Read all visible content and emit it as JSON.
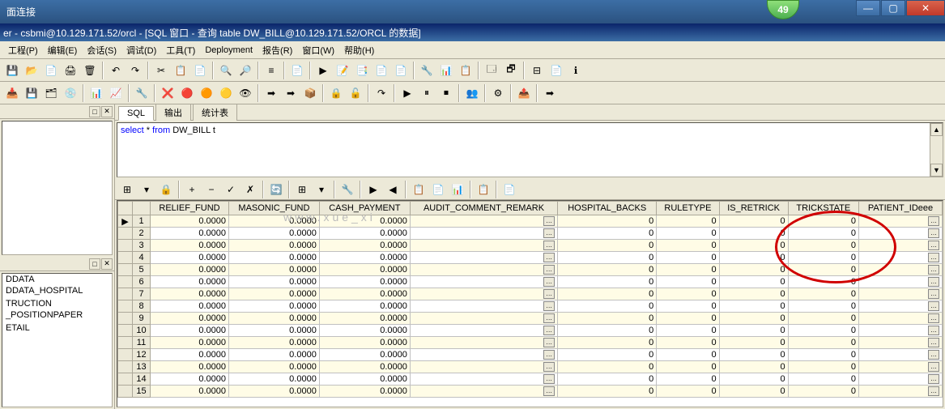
{
  "taskbar": {
    "title": "面连接",
    "badge": "49"
  },
  "titlebar": "er - csbmi@10.129.171.52/orcl - [SQL 窗口 - 查询 table DW_BILL@10.129.171.52/ORCL 的数据]",
  "menu": [
    "工程(P)",
    "编辑(E)",
    "会话(S)",
    "调试(D)",
    "工具(T)",
    "Deployment",
    "报告(R)",
    "窗口(W)",
    "帮助(H)"
  ],
  "tabs": {
    "sql": "SQL",
    "output": "输出",
    "stats": "统计表"
  },
  "sql": {
    "kw_select": "select",
    "star": " * ",
    "kw_from": "from",
    "table": " DW_BILL t"
  },
  "tree_items": [
    "DDATA",
    "DDATA_HOSPITAL",
    "",
    "TRUCTION",
    "_POSITIONPAPER",
    "",
    "ETAIL"
  ],
  "watermark": "www.xue_xi",
  "columns": [
    "RELIEF_FUND",
    "MASONIC_FUND",
    "CASH_PAYMENT",
    "AUDIT_COMMENT_REMARK",
    "HOSPITAL_BACKS",
    "RULETYPE",
    "IS_RETRICK",
    "TRICKSTATE",
    "PATIENT_IDeee"
  ],
  "rows": [
    {
      "n": 1,
      "mark": "▶",
      "r": "0.0000",
      "m": "0.0000",
      "c": "0.0000",
      "a": "…",
      "h": "0",
      "ru": "0",
      "ir": "0",
      "ts": "0",
      "p": "…"
    },
    {
      "n": 2,
      "mark": "",
      "r": "0.0000",
      "m": "0.0000",
      "c": "0.0000",
      "a": "…",
      "h": "0",
      "ru": "0",
      "ir": "0",
      "ts": "0",
      "p": "…"
    },
    {
      "n": 3,
      "mark": "",
      "r": "0.0000",
      "m": "0.0000",
      "c": "0.0000",
      "a": "…",
      "h": "0",
      "ru": "0",
      "ir": "0",
      "ts": "0",
      "p": "…"
    },
    {
      "n": 4,
      "mark": "",
      "r": "0.0000",
      "m": "0.0000",
      "c": "0.0000",
      "a": "…",
      "h": "0",
      "ru": "0",
      "ir": "0",
      "ts": "0",
      "p": "…"
    },
    {
      "n": 5,
      "mark": "",
      "r": "0.0000",
      "m": "0.0000",
      "c": "0.0000",
      "a": "…",
      "h": "0",
      "ru": "0",
      "ir": "0",
      "ts": "0",
      "p": "…"
    },
    {
      "n": 6,
      "mark": "",
      "r": "0.0000",
      "m": "0.0000",
      "c": "0.0000",
      "a": "…",
      "h": "0",
      "ru": "0",
      "ir": "0",
      "ts": "0",
      "p": "…"
    },
    {
      "n": 7,
      "mark": "",
      "r": "0.0000",
      "m": "0.0000",
      "c": "0.0000",
      "a": "…",
      "h": "0",
      "ru": "0",
      "ir": "0",
      "ts": "0",
      "p": "…"
    },
    {
      "n": 8,
      "mark": "",
      "r": "0.0000",
      "m": "0.0000",
      "c": "0.0000",
      "a": "…",
      "h": "0",
      "ru": "0",
      "ir": "0",
      "ts": "0",
      "p": "…"
    },
    {
      "n": 9,
      "mark": "",
      "r": "0.0000",
      "m": "0.0000",
      "c": "0.0000",
      "a": "…",
      "h": "0",
      "ru": "0",
      "ir": "0",
      "ts": "0",
      "p": "…"
    },
    {
      "n": 10,
      "mark": "",
      "r": "0.0000",
      "m": "0.0000",
      "c": "0.0000",
      "a": "…",
      "h": "0",
      "ru": "0",
      "ir": "0",
      "ts": "0",
      "p": "…"
    },
    {
      "n": 11,
      "mark": "",
      "r": "0.0000",
      "m": "0.0000",
      "c": "0.0000",
      "a": "…",
      "h": "0",
      "ru": "0",
      "ir": "0",
      "ts": "0",
      "p": "…"
    },
    {
      "n": 12,
      "mark": "",
      "r": "0.0000",
      "m": "0.0000",
      "c": "0.0000",
      "a": "…",
      "h": "0",
      "ru": "0",
      "ir": "0",
      "ts": "0",
      "p": "…"
    },
    {
      "n": 13,
      "mark": "",
      "r": "0.0000",
      "m": "0.0000",
      "c": "0.0000",
      "a": "…",
      "h": "0",
      "ru": "0",
      "ir": "0",
      "ts": "0",
      "p": "…"
    },
    {
      "n": 14,
      "mark": "",
      "r": "0.0000",
      "m": "0.0000",
      "c": "0.0000",
      "a": "…",
      "h": "0",
      "ru": "0",
      "ir": "0",
      "ts": "0",
      "p": "…"
    },
    {
      "n": 15,
      "mark": "",
      "r": "0.0000",
      "m": "0.0000",
      "c": "0.0000",
      "a": "…",
      "h": "0",
      "ru": "0",
      "ir": "0",
      "ts": "0",
      "p": "…"
    }
  ],
  "toolbar1": [
    "💾",
    "📂",
    "📄",
    "🖨",
    "🗑",
    "",
    "↶",
    "↷",
    "",
    "✂",
    "📋",
    "📄",
    "",
    "🔍",
    "🔎",
    "",
    "≡",
    "",
    "📄",
    "",
    "▶",
    "📝",
    "📑",
    "📄",
    "📄",
    "",
    "🔧",
    "📊",
    "📋",
    "",
    "🗔",
    "🗗",
    "",
    "⊟",
    "📄",
    "ℹ"
  ],
  "toolbar2": [
    "📥",
    "💾",
    "🗂",
    "💿",
    "",
    "📊",
    "📈",
    "",
    "🔧",
    "",
    "❌",
    "🔴",
    "🟠",
    "🟡",
    "👁",
    "",
    "➡",
    "➡",
    "📦",
    "",
    "🔒",
    "🔓",
    "",
    "↷",
    "",
    "▶",
    "⏸",
    "⏹",
    "",
    "👥",
    "",
    "⚙",
    "",
    "📤",
    "",
    "➡"
  ],
  "grid_toolbar": [
    "⊞",
    "▾",
    "🔒",
    "",
    "+",
    "−",
    "✓",
    "✗",
    "",
    "🔄",
    "",
    "⊞",
    "▾",
    "",
    "🔧",
    "",
    "▶",
    "◀",
    "",
    "📋",
    "📄",
    "📊",
    "",
    "📋",
    "",
    "📄"
  ]
}
